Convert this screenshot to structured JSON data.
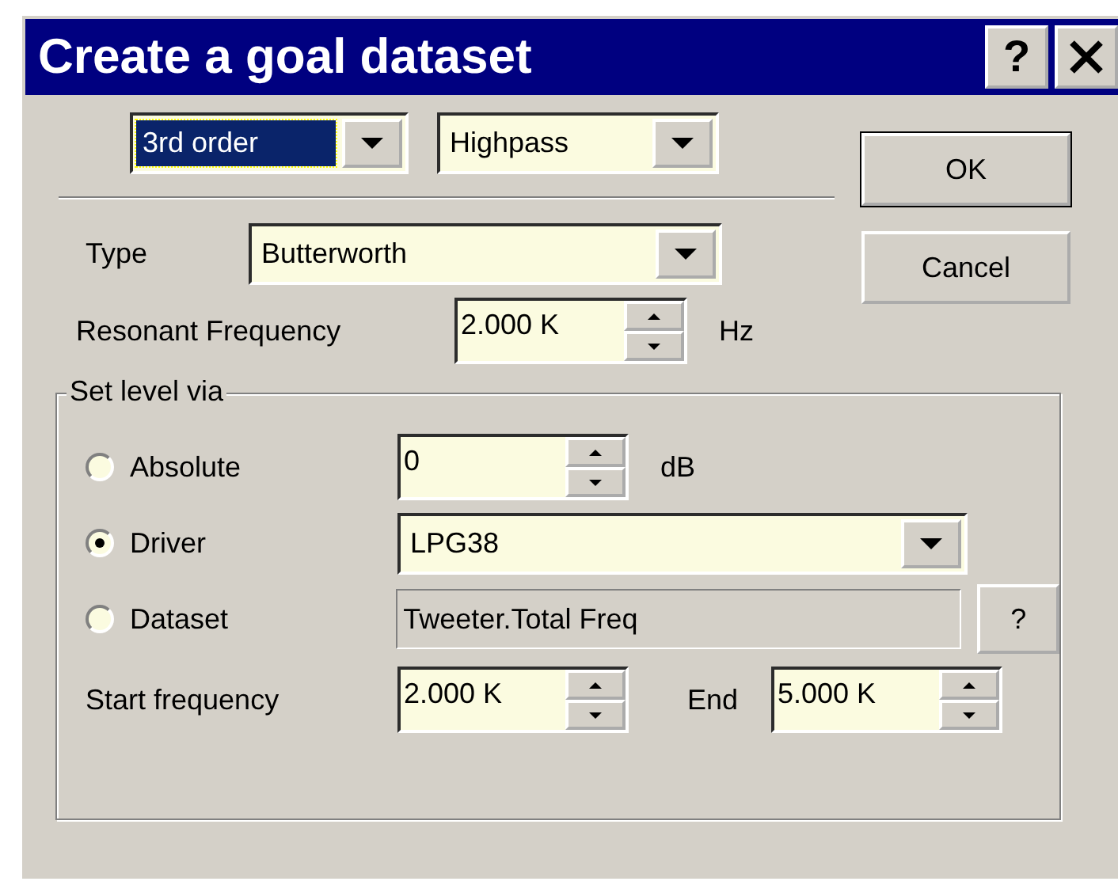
{
  "window": {
    "title": "Create a goal dataset",
    "help_button": "?"
  },
  "filter": [
    {
      "value": "3rd order",
      "highlighted": true
    },
    {
      "value": "Highpass",
      "highlighted": false
    }
  ],
  "type": {
    "label": "Type",
    "value": "Butterworth"
  },
  "resonant_frequency": {
    "label": "Resonant Frequency",
    "value": "2.000 K",
    "unit": "Hz"
  },
  "set_level": {
    "legend": "Set level via",
    "options": [
      {
        "kind": "spin",
        "label": "Absolute",
        "selected": false,
        "value": "0",
        "unit": "dB"
      },
      {
        "kind": "dropdown",
        "label": "Driver",
        "selected": true,
        "value": "LPG38"
      },
      {
        "kind": "readonly",
        "label": "Dataset",
        "selected": false,
        "value": "Tweeter.Total Freq",
        "button": "?"
      }
    ],
    "start": {
      "label": "Start frequency",
      "value": "2.000 K"
    },
    "end": {
      "label": "End",
      "value": "5.000 K"
    }
  },
  "buttons": [
    "OK",
    "Cancel"
  ]
}
